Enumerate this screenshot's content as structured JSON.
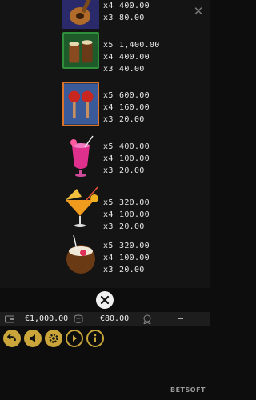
{
  "paytable": {
    "close_icon": "close-icon",
    "symbols": [
      {
        "id": "guitar",
        "icon": "guitar-icon",
        "pays": [
          {
            "mult": "x4",
            "amount": "400.00"
          },
          {
            "mult": "x3",
            "amount": "80.00"
          }
        ]
      },
      {
        "id": "drums",
        "icon": "bongo-drums-icon",
        "pays": [
          {
            "mult": "x5",
            "amount": "1,400.00"
          },
          {
            "mult": "x4",
            "amount": "400.00"
          },
          {
            "mult": "x3",
            "amount": "40.00"
          }
        ]
      },
      {
        "id": "maracas",
        "icon": "maracas-icon",
        "pays": [
          {
            "mult": "x5",
            "amount": "600.00"
          },
          {
            "mult": "x4",
            "amount": "160.00"
          },
          {
            "mult": "x3",
            "amount": "20.00"
          }
        ]
      },
      {
        "id": "pink-cocktail",
        "icon": "pink-cocktail-icon",
        "pays": [
          {
            "mult": "x5",
            "amount": "400.00"
          },
          {
            "mult": "x4",
            "amount": "100.00"
          },
          {
            "mult": "x3",
            "amount": "20.00"
          }
        ]
      },
      {
        "id": "orange-cocktail",
        "icon": "orange-cocktail-icon",
        "pays": [
          {
            "mult": "x5",
            "amount": "320.00"
          },
          {
            "mult": "x4",
            "amount": "100.00"
          },
          {
            "mult": "x3",
            "amount": "20.00"
          }
        ]
      },
      {
        "id": "coconut-drink",
        "icon": "coconut-drink-icon",
        "pays": [
          {
            "mult": "x5",
            "amount": "320.00"
          },
          {
            "mult": "x4",
            "amount": "100.00"
          },
          {
            "mult": "x3",
            "amount": "20.00"
          }
        ]
      }
    ]
  },
  "statusbar": {
    "balance": "€1,000.00",
    "bet": "€80.00",
    "win": "–"
  },
  "logo": "BETSOFT",
  "colors": {
    "gold": "#c9a53a",
    "green_frame": "#2f8f3b",
    "orange_frame": "#d9742a",
    "background": "#141414"
  }
}
